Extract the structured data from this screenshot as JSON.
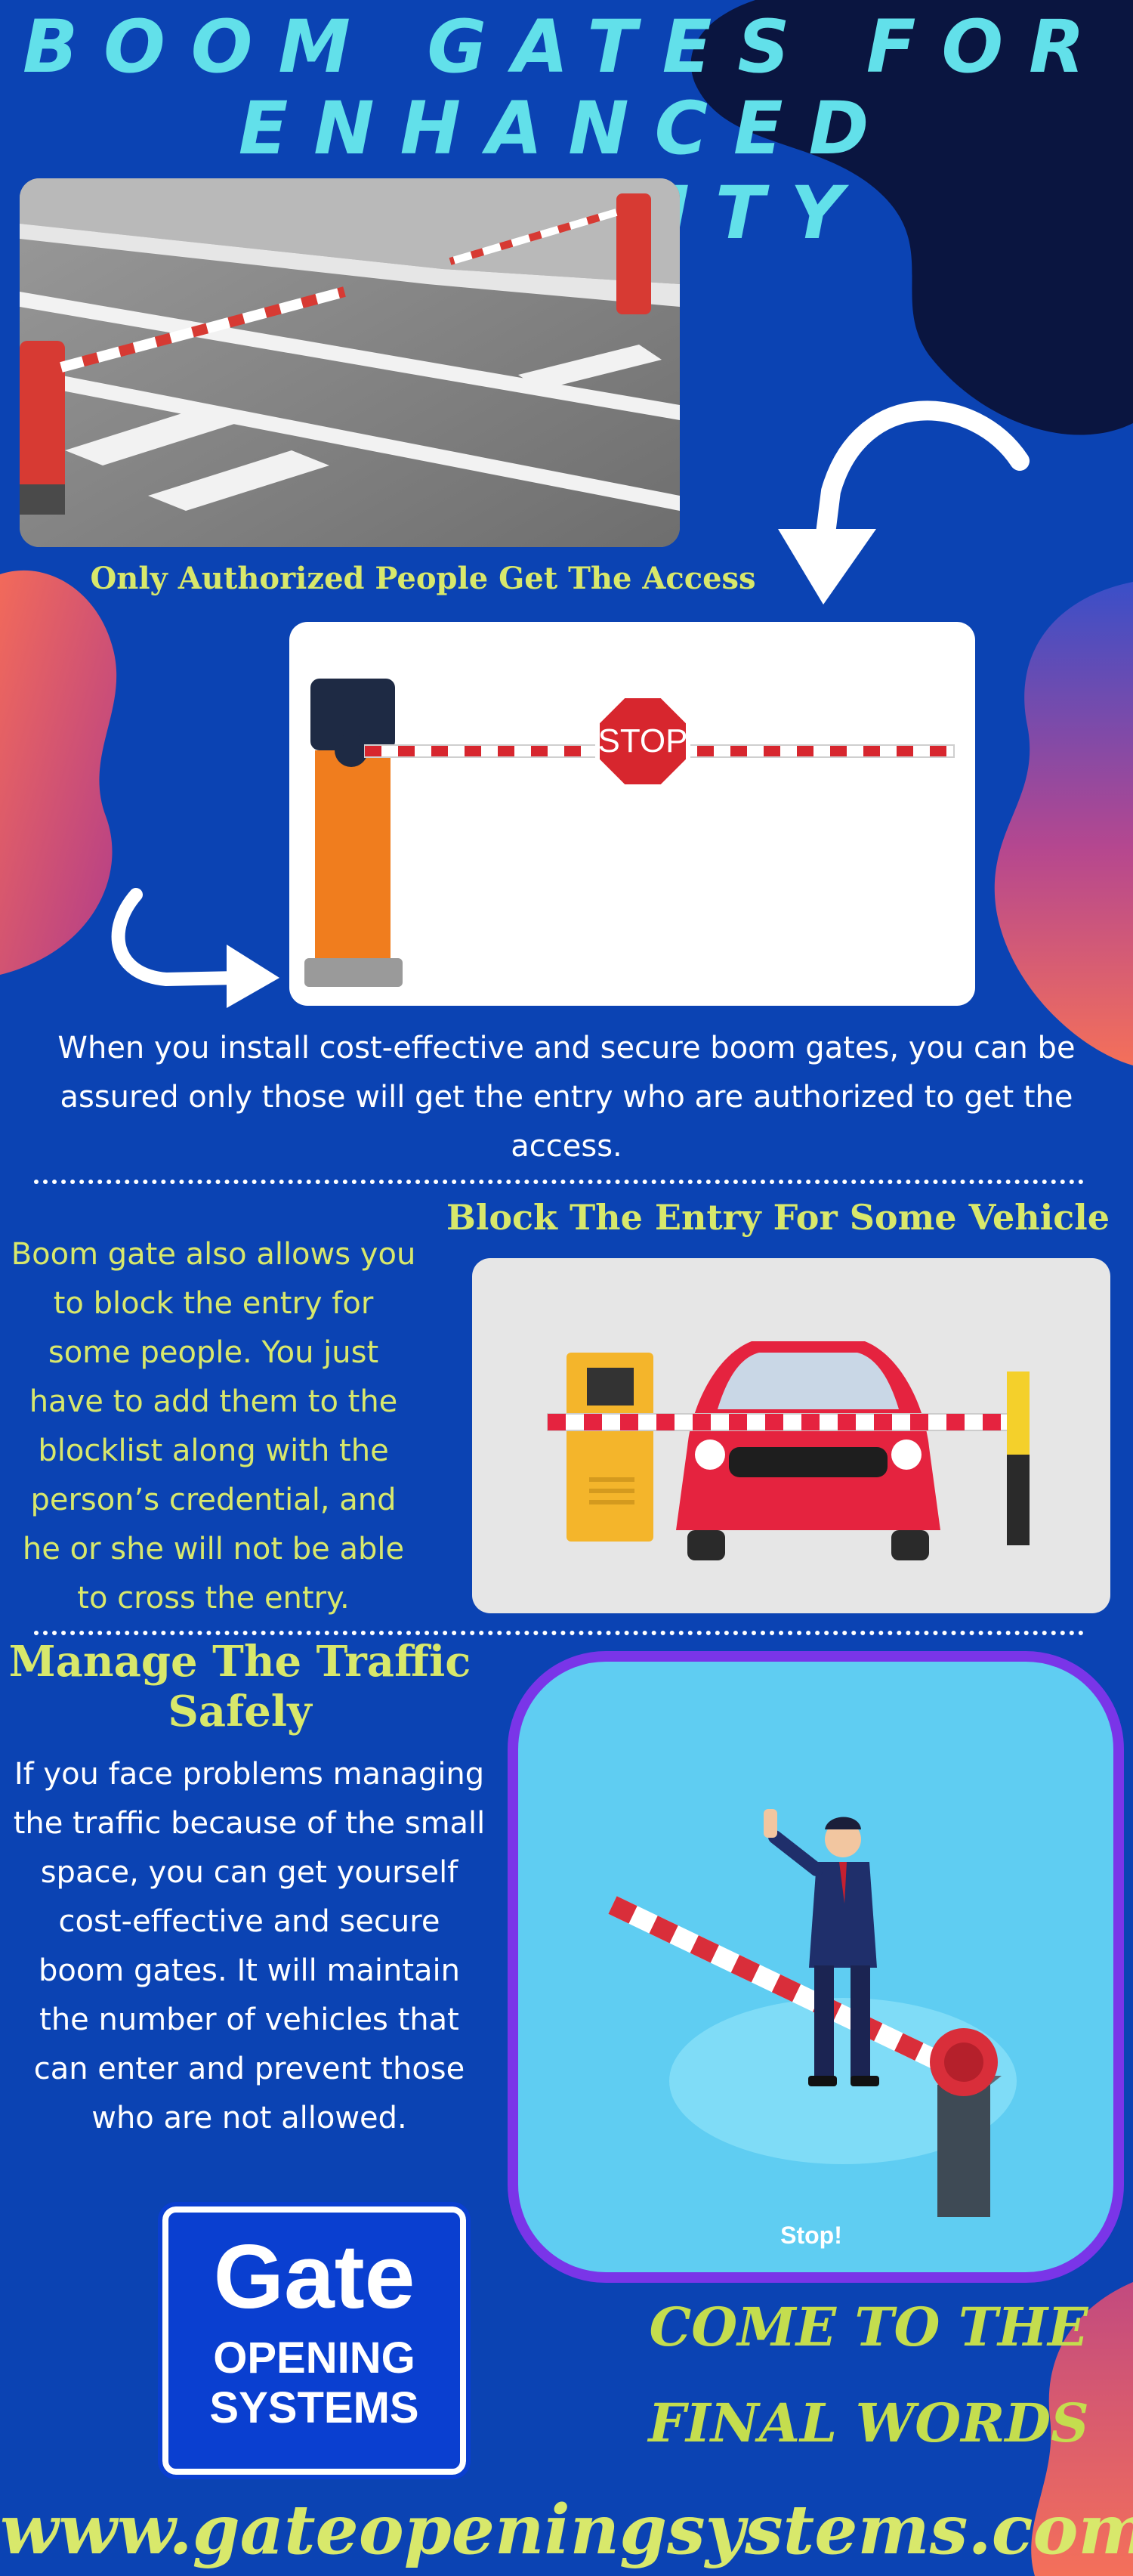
{
  "header": {
    "title_line1": "BOOM GATES FOR",
    "title_line2": "ENHANCED SECURITY"
  },
  "section1": {
    "caption": "Only Authorized People Get The Access",
    "stop_sign_text": "STOP",
    "paragraph": "When you install cost-effective and secure boom gates, you can be assured only those will get the entry who are authorized to get the access."
  },
  "section2": {
    "heading": "Block The Entry For Some Vehicle",
    "paragraph": "Boom gate also allows you to block the entry for some people. You just have to add them to the blocklist along with the person’s credential, and he or she will not be able to cross the entry."
  },
  "section3": {
    "heading": "Manage The Traffic Safely",
    "paragraph": "If you face problems managing the traffic because of the small space, you can get yourself cost-effective and secure boom gates. It will maintain the number of vehicles that can enter and prevent those who are not allowed.",
    "illustration_caption": "Stop!"
  },
  "logo": {
    "word1": "Gate",
    "word2": "OPENING",
    "word3": "SYSTEMS"
  },
  "closing": {
    "line1": "COME TO THE",
    "line2": "FINAL WORDS"
  },
  "footer": {
    "url": "www.gateopeningsystems.com.au"
  },
  "colors": {
    "background": "#0b43b3",
    "title": "#62e0ea",
    "accent_yellow": "#d8e86b",
    "coral": "#f26a5a",
    "navy": "#0a1540"
  }
}
